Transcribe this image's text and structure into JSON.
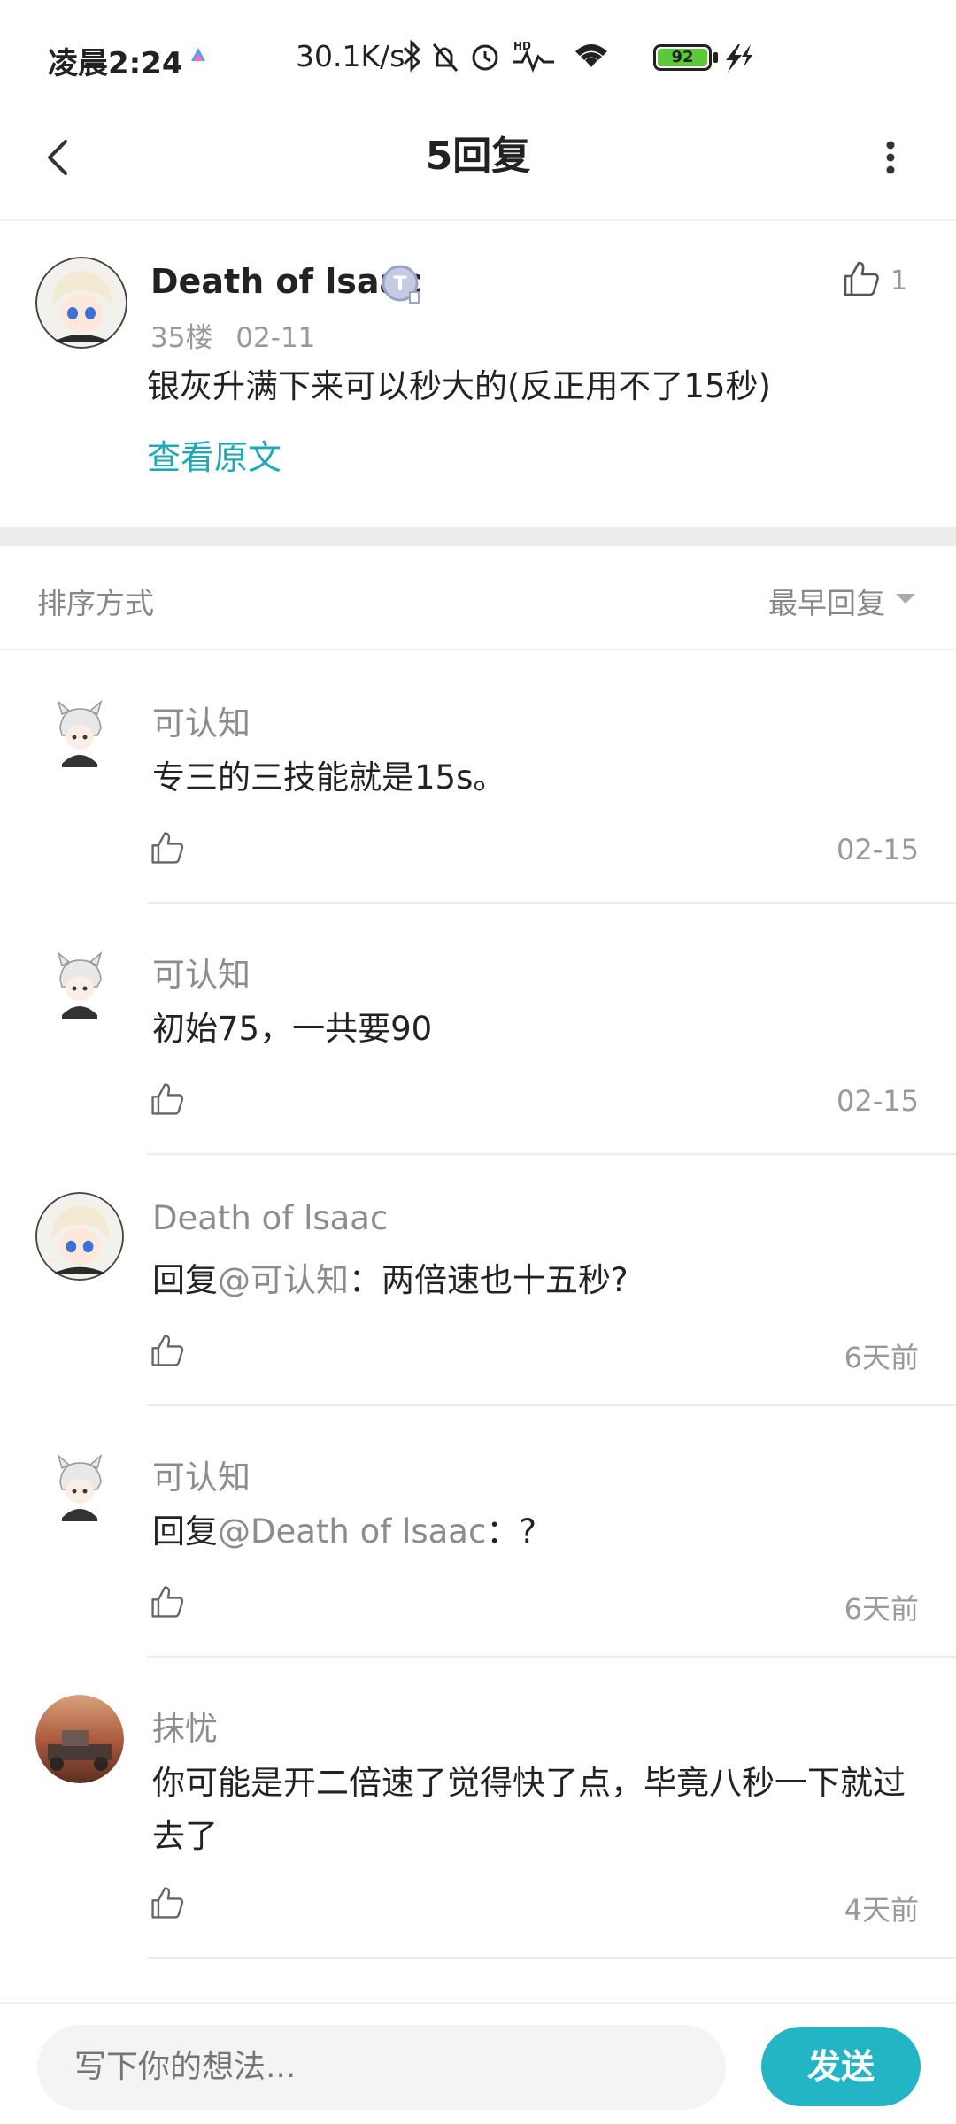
{
  "status_bar": {
    "time": "凌晨2:24",
    "network_speed": "30.1K/s",
    "battery": "92",
    "icons": [
      "bluetooth-icon",
      "mute-icon",
      "alarm-icon",
      "hd-signal-icon",
      "wifi-icon",
      "battery-icon",
      "charging-icon"
    ]
  },
  "header": {
    "title": "5回复"
  },
  "post": {
    "author": "Death of lsaac",
    "badge": "T",
    "floor": "35楼",
    "date": "02-11",
    "body": "银灰升满下来可以秒大的(反正用不了15秒)",
    "view_original": "查看原文",
    "like_count": "1"
  },
  "sort": {
    "label": "排序方式",
    "value": "最早回复"
  },
  "replies": [
    {
      "user": "可认知",
      "text": "专三的三技能就是15s。",
      "time": "02-15"
    },
    {
      "user": "可认知",
      "text": "初始75，一共要90",
      "time": "02-15"
    },
    {
      "user": "Death of lsaac",
      "reply_prefix": "回复",
      "mention": "@可认知",
      "text": "：两倍速也十五秒?",
      "time": "6天前"
    },
    {
      "user": "可认知",
      "reply_prefix": "回复",
      "mention": "@Death of lsaac",
      "text": "：?",
      "time": "6天前"
    },
    {
      "user": "抹忧",
      "text": "你可能是开二倍速了觉得快了点，毕竟八秒一下就过去了",
      "time": "4天前"
    }
  ],
  "input": {
    "placeholder": "写下你的想法...",
    "send_label": "发送"
  },
  "colors": {
    "accent": "#23b5c3",
    "link": "#1fa9b8",
    "muted_text": "#8c8c8c"
  }
}
